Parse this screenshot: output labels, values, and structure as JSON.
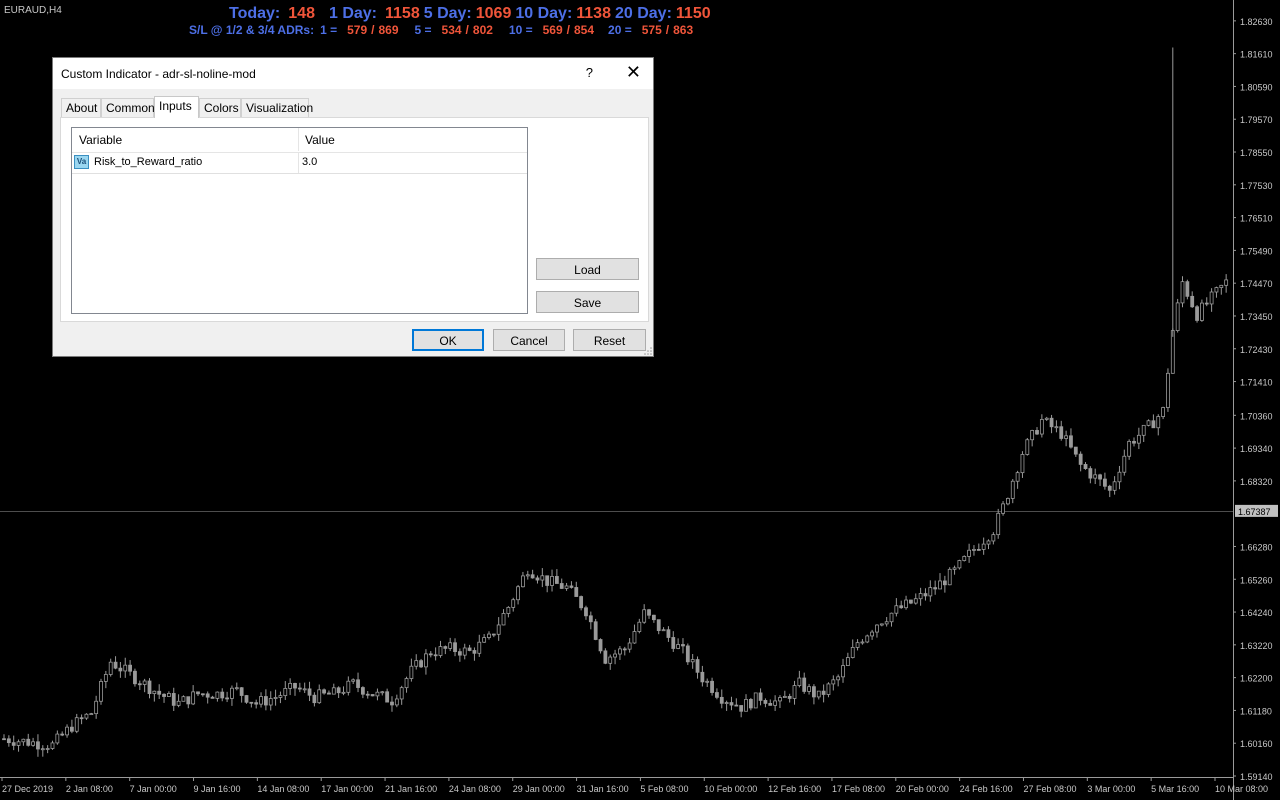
{
  "symbol_label": "EURAUD,H4",
  "adr": {
    "row1": [
      {
        "text": "Today:",
        "color": "blue"
      },
      {
        "text": "148",
        "color": "red"
      },
      {
        "text": "1 Day:",
        "color": "blue"
      },
      {
        "text": "1158",
        "color": "red"
      },
      {
        "text": "5 Day:",
        "color": "blue"
      },
      {
        "text": "1069",
        "color": "red"
      },
      {
        "text": "10 Day:",
        "color": "blue"
      },
      {
        "text": "1138",
        "color": "red"
      },
      {
        "text": "20 Day:",
        "color": "blue"
      },
      {
        "text": "1150",
        "color": "red"
      }
    ],
    "row2": [
      {
        "text": "S/L @ 1/2 & 3/4 ADRs:",
        "color": "blue"
      },
      {
        "text": "1 =",
        "color": "blue"
      },
      {
        "text": "579",
        "color": "red"
      },
      {
        "text": "/",
        "color": "red"
      },
      {
        "text": "869",
        "color": "red"
      },
      {
        "text": "5 =",
        "color": "blue"
      },
      {
        "text": "534",
        "color": "red"
      },
      {
        "text": "/",
        "color": "red"
      },
      {
        "text": "802",
        "color": "red"
      },
      {
        "text": "10 =",
        "color": "blue"
      },
      {
        "text": "569",
        "color": "red"
      },
      {
        "text": "/",
        "color": "red"
      },
      {
        "text": "854",
        "color": "red"
      },
      {
        "text": "20 =",
        "color": "blue"
      },
      {
        "text": "575",
        "color": "red"
      },
      {
        "text": "/",
        "color": "red"
      },
      {
        "text": "863",
        "color": "red"
      }
    ]
  },
  "colors": {
    "blue": "#4d6fe6",
    "red": "#f0553a",
    "background": "#000000",
    "candle": "#9a9a9a",
    "current_price_line": "#9a9a9a"
  },
  "chart_data": {
    "type": "candlestick",
    "symbol": "EURAUD",
    "timeframe": "H4",
    "current_price": "1.67387",
    "ylim": [
      1.5914,
      1.8275
    ],
    "price_ticks": [
      "1.82630",
      "1.81610",
      "1.80590",
      "1.79570",
      "1.78550",
      "1.77530",
      "1.76510",
      "1.75490",
      "1.74470",
      "1.73450",
      "1.72430",
      "1.71410",
      "1.70360",
      "1.69340",
      "1.68320",
      "1.67387",
      "1.66280",
      "1.65260",
      "1.64240",
      "1.63220",
      "1.62200",
      "1.61180",
      "1.60160",
      "1.59140"
    ],
    "time_ticks": [
      "27 Dec 2019",
      "2 Jan 08:00",
      "7 Jan 00:00",
      "9 Jan 16:00",
      "14 Jan 08:00",
      "17 Jan 00:00",
      "21 Jan 16:00",
      "24 Jan 08:00",
      "29 Jan 00:00",
      "31 Jan 16:00",
      "5 Feb 08:00",
      "10 Feb 00:00",
      "12 Feb 16:00",
      "17 Feb 08:00",
      "20 Feb 00:00",
      "24 Feb 16:00",
      "27 Feb 08:00",
      "3 Mar 00:00",
      "5 Mar 16:00",
      "10 Mar 08:00"
    ],
    "close_path": [
      [
        0,
        1.603
      ],
      [
        10,
        1.601
      ],
      [
        14,
        1.607
      ],
      [
        18,
        1.611
      ],
      [
        22,
        1.627
      ],
      [
        24,
        1.625
      ],
      [
        28,
        1.621
      ],
      [
        32,
        1.617
      ],
      [
        36,
        1.614
      ],
      [
        40,
        1.617
      ],
      [
        44,
        1.617
      ],
      [
        48,
        1.618
      ],
      [
        52,
        1.614
      ],
      [
        56,
        1.616
      ],
      [
        60,
        1.619
      ],
      [
        64,
        1.616
      ],
      [
        68,
        1.617
      ],
      [
        72,
        1.62
      ],
      [
        76,
        1.617
      ],
      [
        80,
        1.615
      ],
      [
        84,
        1.624
      ],
      [
        88,
        1.63
      ],
      [
        92,
        1.631
      ],
      [
        96,
        1.63
      ],
      [
        100,
        1.634
      ],
      [
        104,
        1.644
      ],
      [
        108,
        1.656
      ],
      [
        112,
        1.652
      ],
      [
        116,
        1.65
      ],
      [
        120,
        1.643
      ],
      [
        124,
        1.628
      ],
      [
        128,
        1.631
      ],
      [
        132,
        1.642
      ],
      [
        136,
        1.636
      ],
      [
        140,
        1.63
      ],
      [
        144,
        1.622
      ],
      [
        148,
        1.616
      ],
      [
        152,
        1.613
      ],
      [
        156,
        1.616
      ],
      [
        160,
        1.614
      ],
      [
        164,
        1.62
      ],
      [
        168,
        1.616
      ],
      [
        172,
        1.622
      ],
      [
        176,
        1.633
      ],
      [
        180,
        1.639
      ],
      [
        184,
        1.643
      ],
      [
        188,
        1.646
      ],
      [
        192,
        1.65
      ],
      [
        196,
        1.655
      ],
      [
        200,
        1.662
      ],
      [
        204,
        1.668
      ],
      [
        206,
        1.675
      ],
      [
        210,
        1.692
      ],
      [
        214,
        1.702
      ],
      [
        218,
        1.698
      ],
      [
        222,
        1.688
      ],
      [
        226,
        1.683
      ],
      [
        228,
        1.68
      ],
      [
        232,
        1.695
      ],
      [
        236,
        1.7
      ],
      [
        239,
        1.705
      ],
      [
        241,
        1.73
      ],
      [
        243,
        1.745
      ],
      [
        246,
        1.735
      ],
      [
        249,
        1.74
      ],
      [
        252,
        1.745
      ]
    ]
  },
  "dialog": {
    "title": "Custom Indicator - adr-sl-noline-mod",
    "help_glyph": "?",
    "close_glyph": "✕",
    "tabs": [
      "About",
      "Common",
      "Inputs",
      "Colors",
      "Visualization"
    ],
    "active_tab": "Inputs",
    "columns": [
      "Variable",
      "Value"
    ],
    "rows": [
      {
        "icon_text": "Va",
        "variable": "Risk_to_Reward_ratio",
        "value": "3.0"
      }
    ],
    "buttons": {
      "load": "Load",
      "save": "Save",
      "ok": "OK",
      "cancel": "Cancel",
      "reset": "Reset"
    }
  }
}
